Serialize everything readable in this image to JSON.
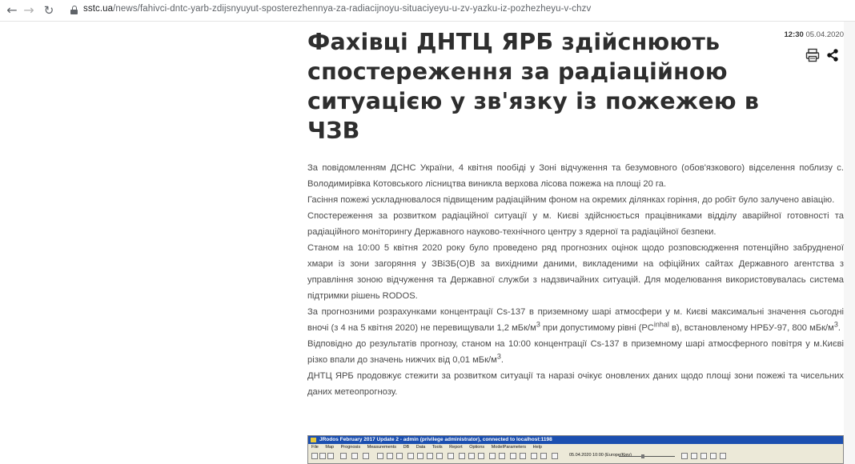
{
  "browser": {
    "url_host": "sstc.ua",
    "url_path": "/news/fahivci-dntc-yarb-zdijsnyuyut-sposterezhennya-za-radiacijnoyu-situaciyeyu-u-zv-yazku-iz-pozhezheyu-v-chzv"
  },
  "article": {
    "title": "Фахівці ДНТЦ ЯРБ здійснюють спостереження за радіаційною ситуацією у зв'язку із пожежею в ЧЗВ",
    "time": "12:30",
    "date": "05.04.2020",
    "paragraphs": {
      "p1": "За повідомленням ДСНС України, 4 квітня пообіді у Зоні відчуження та безумовного (обов'язкового) відселення поблизу с. Володимирівка Котовського лісництва виникла верхова лісова пожежа на площі 20 га.",
      "p2": "Гасіння пожежі ускладнювалося підвищеним радіаційним фоном на окремих ділянках горіння, до робіт було залучено авіацію.",
      "p3": "Спостереження за розвитком радіаційної ситуації у м. Києві здійснюється працівниками відділу аварійної готовності та радіаційного моніторингу Державного науково-технічного центру з ядерної та радіаційної безпеки.",
      "p4": "Станом на 10:00 5 квітня 2020 року було проведено ряд прогнозних оцінок щодо розповсюдження потенційно забрудненої хмари із зони загоряння у ЗВіЗБ(О)В за вихідними даними, викладеними на офіційних сайтах Державного агентства з управління зоною відчуження та Державної служби з надзвичайних ситуацій. Для моделювання використовувалась система підтримки рішень RODOS.",
      "p5a": "За прогнозними розрахунками концентрації Cs-137 в приземному шарі атмосфери у м. Києві максимальні значення сьогодні вночі (з 4 на 5 квітня 2020) не перевищували 1,2 мБк/м",
      "p5sup1": "3",
      "p5b": " при допустимому рівні (РС",
      "p5sup2": "inhal",
      "p5c": " в), встановленому НРБУ-97, 800 мБк/м",
      "p5sup3": "3",
      "p5d": ".",
      "p6a": "Відповідно до результатів прогнозу, станом на 10:00 концентрації Cs-137 в приземному шарі атмосферного повітря у м.Києві різко впали до значень нижчих від 0,01 мБк/м",
      "p6sup": "3",
      "p6b": ".",
      "p7": "ДНТЦ ЯРБ продовжує стежити за розвитком ситуації та наразі очікує оновлених даних щодо площі зони пожежі та чисельних даних метеопрогнозу."
    }
  },
  "app_screenshot": {
    "title": "JRodos February 2017 Update 2 - admin (privilege administrator), connected to localhost:1198",
    "menu": [
      "File",
      "Map",
      "Prognosis",
      "Measurements",
      "DB",
      "Data",
      "Tools",
      "Report",
      "Options",
      "ModelParameters",
      "Help"
    ],
    "date_label": "05.04.2020 10:00 (Europe/Kiev)"
  },
  "colors": {
    "title_text": "#2e2e2e",
    "body_text": "#4a4a4a",
    "app_titlebar": "#1b4fb0"
  }
}
